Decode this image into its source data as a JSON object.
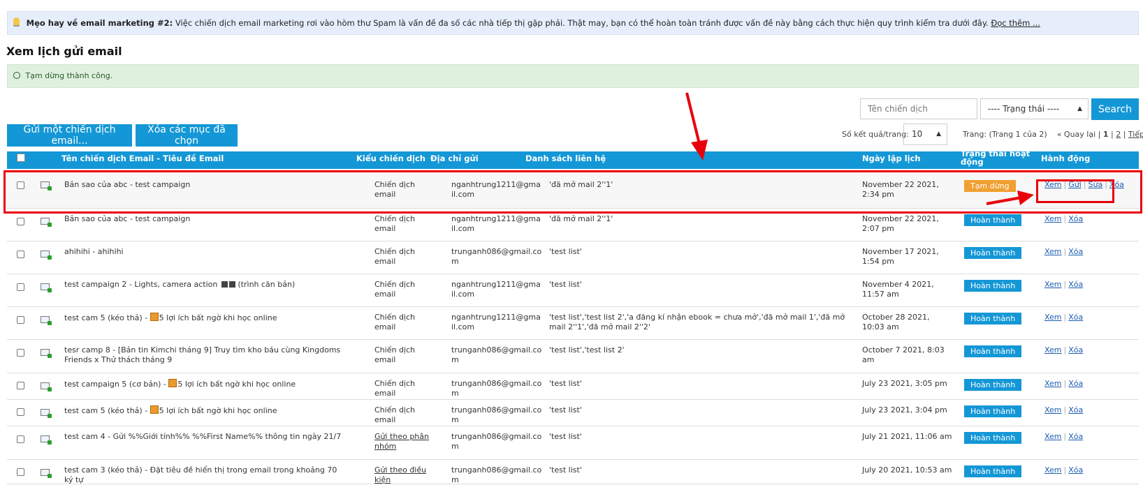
{
  "tip": {
    "label": "Mẹo hay về email marketing #2:",
    "text": "Việc chiến dịch email marketing rơi vào hòm thư Spam là vấn đề đa số các nhà tiếp thị gặp phải. Thật may, bạn có thể hoàn toàn tránh được vấn đề này bằng cách thực hiện quy trình kiểm tra dưới đây.",
    "link": "Đọc thêm ..."
  },
  "page_title": "Xem lịch gửi email",
  "success_message": "Tạm dừng thành công.",
  "filters": {
    "search_placeholder": "Tên chiến dịch",
    "status_select": "---- Trạng thái ----",
    "search_button": "Search"
  },
  "actions_bar": {
    "send_button": "Gửi một chiến dịch email...",
    "delete_button": "Xóa các mục đã chọn",
    "per_page_label": "Số kết quả/trang:",
    "per_page_value": "10"
  },
  "pagination": {
    "info": "Trang: (Trang 1 của 2)",
    "first": "«",
    "back": "Quay lại",
    "page1": "1",
    "page2": "2",
    "next": "Tiếp",
    "last": "»"
  },
  "table": {
    "headers": {
      "name": "Tên chiến dịch Email - Tiêu đề Email",
      "type": "Kiểu chiến dịch",
      "sender": "Địa chỉ gửi",
      "contacts": "Danh sách liên hệ",
      "date": "Ngày lập lịch",
      "status": "Trạng thái hoạt động",
      "actions": "Hành động"
    },
    "action_labels": {
      "view": "Xem",
      "send": "Gửi",
      "edit": "Sửa",
      "delete": "Xóa"
    },
    "rows": [
      {
        "name": "Bản sao của abc - test campaign",
        "type": "Chiến dịch email",
        "email": "nganhtrung1211@gmail.com",
        "list": "'đã mở mail 2''1'",
        "date": "November 22 2021, 2:34 pm",
        "status": "Tạm dừng"
      },
      {
        "name": "Bản sao của abc - test campaign",
        "type": "Chiến dịch email",
        "email": "nganhtrung1211@gmail.com",
        "list": "'đã mở mail 2''1'",
        "date": "November 22 2021, 2:07 pm",
        "status": "Hoàn thành"
      },
      {
        "name": "ahihihi - ahihihi",
        "type": "Chiến dịch email",
        "email": "trunganh086@gmail.com",
        "list": "'test list'",
        "date": "November 17 2021, 1:54 pm",
        "status": "Hoàn thành"
      },
      {
        "name": "test campaign 2 - Lights, camera action",
        "name_suffix": "(trình căn bản)",
        "type": "Chiến dịch email",
        "email": "nganhtrung1211@gmail.com",
        "list": "'test list'",
        "date": "November 4 2021, 11:57 am",
        "status": "Hoàn thành"
      },
      {
        "name_prefix": "test cam 5 (kéo thả) -",
        "name": "5 lợi ích bất ngờ khi học online",
        "type": "Chiến dịch email",
        "email": "nganhtrung1211@gmail.com",
        "list": "'test list','test list 2','a đăng kí nhận ebook = chưa mở','đã mở mail 1','đã mở mail 2''1','đã mở mail 2''2'",
        "date": "October 28 2021, 10:03 am",
        "status": "Hoàn thành"
      },
      {
        "name": "tesr camp 8 - [Bản tin Kimchi tháng 9] Truy tìm kho báu cùng Kingdoms Friends x Thử thách tháng 9",
        "type": "Chiến dịch email",
        "email": "trunganh086@gmail.com",
        "list": "'test list','test list 2'",
        "date": "October 7 2021, 8:03 am",
        "status": "Hoàn thành"
      },
      {
        "name_prefix": "test campaign 5 (cơ bản) -",
        "name": "5 lợi ích bất ngờ khi học online",
        "type": "Chiến dịch email",
        "email": "trunganh086@gmail.com",
        "list": "'test list'",
        "date": "July 23 2021, 3:05 pm",
        "status": "Hoàn thành"
      },
      {
        "name_prefix": "test cam 5 (kéo thả) -",
        "name": "5 lợi ích bất ngờ khi học online",
        "type": "Chiến dịch email",
        "email": "trunganh086@gmail.com",
        "list": "'test list'",
        "date": "July 23 2021, 3:04 pm",
        "status": "Hoàn thành"
      },
      {
        "name": "test cam 4 - Gửi %%Giới tính%% %%First Name%% thông tin ngày 21/7",
        "type": "Gửi theo phân nhóm",
        "email": "trunganh086@gmail.com",
        "list": "'test list'",
        "date": "July 21 2021, 11:06 am",
        "status": "Hoàn thành"
      },
      {
        "name": "test cam 3 (kéo thả) - Đặt tiêu đề hiển thị trong email trong khoảng 70 ký tự",
        "type": "Gửi theo điều kiện",
        "email": "trunganh086@gmail.com",
        "list": "'test list'",
        "date": "July 20 2021, 10:53 am",
        "status": "Hoàn thành"
      }
    ]
  },
  "colors": {
    "accent": "#1497d6",
    "paused": "#f0a030",
    "annotation": "#e8000b",
    "success_bg": "#dff0df",
    "tip_bg": "#e6eefc"
  }
}
